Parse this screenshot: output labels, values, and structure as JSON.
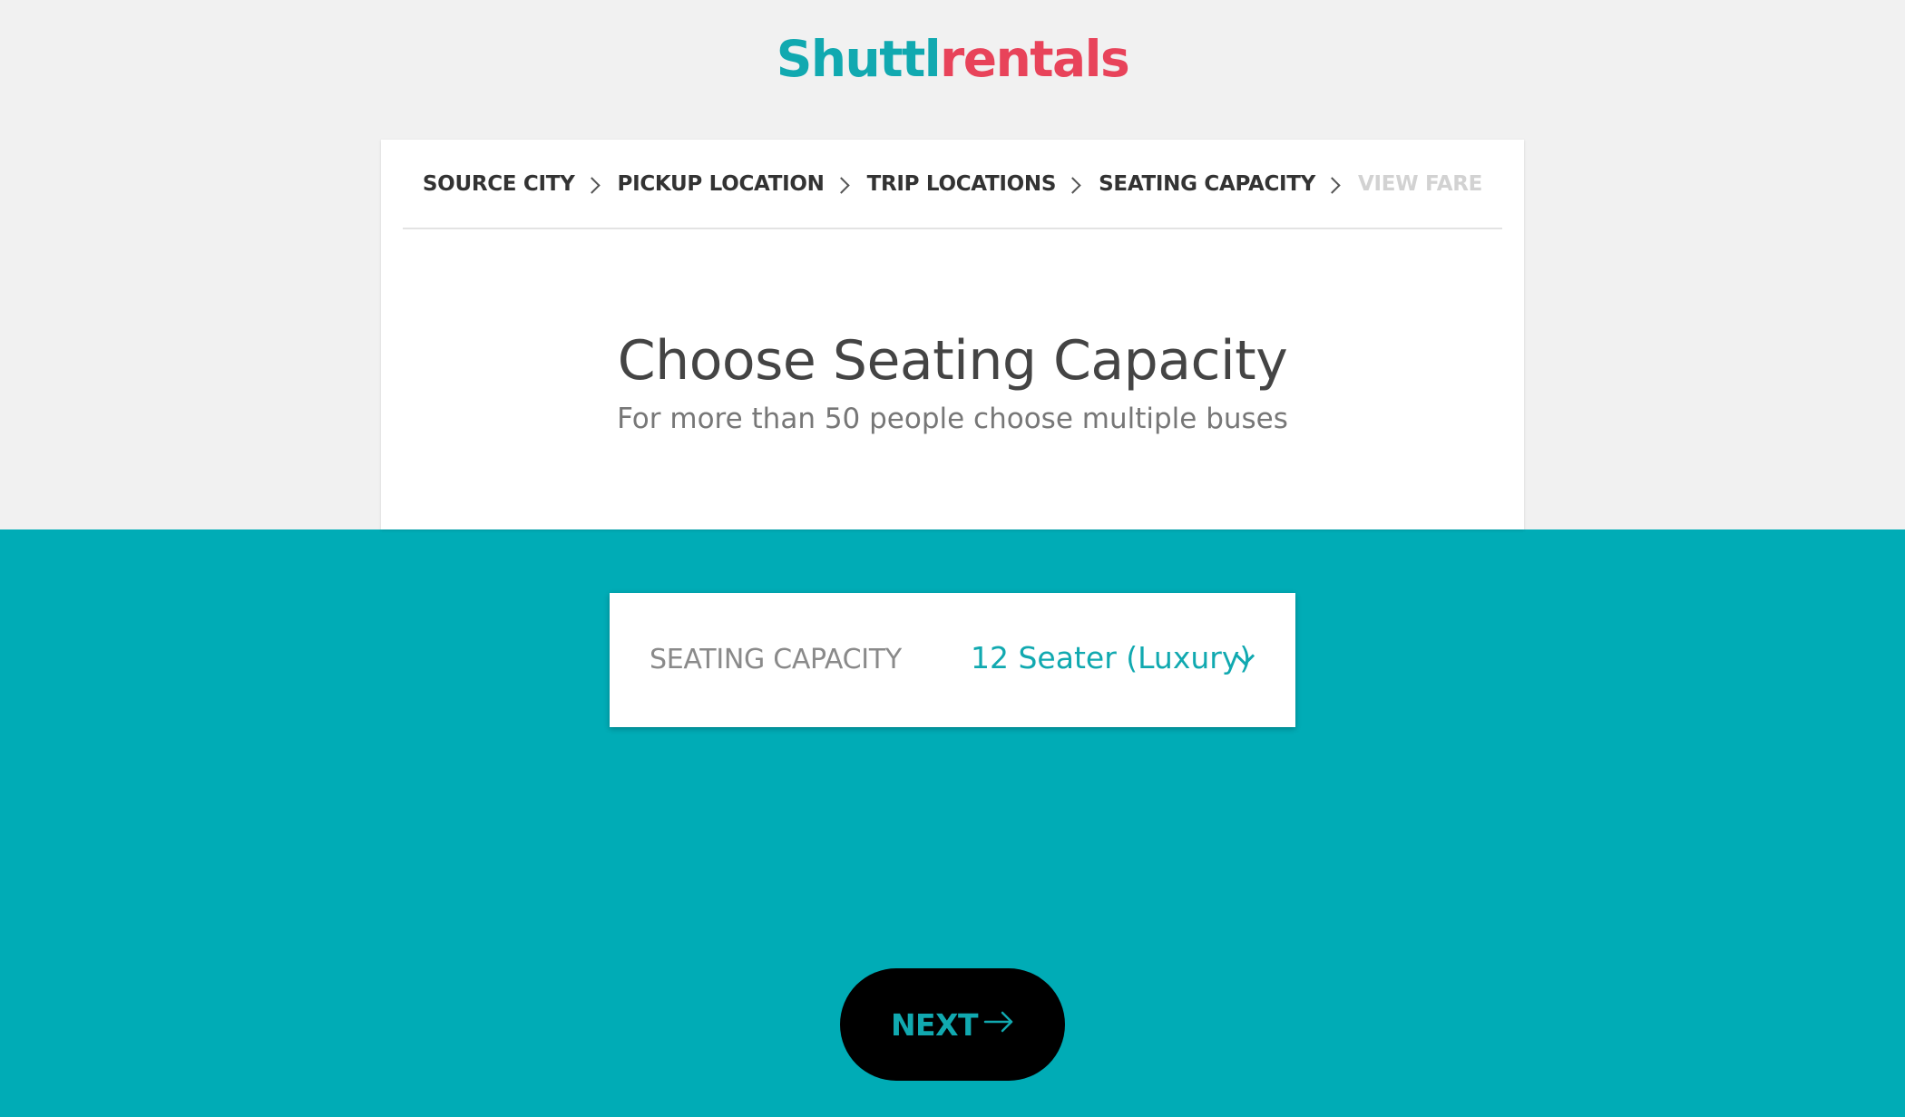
{
  "brand": {
    "logo_part1": "Shuttl",
    "logo_part2": "rentals",
    "primary_color": "#11a9b0",
    "accent_color": "#e8435a",
    "teal_bg": "#00acb6"
  },
  "breadcrumb": {
    "steps": [
      {
        "label": "SOURCE CITY",
        "state": "done"
      },
      {
        "label": "PICKUP LOCATION",
        "state": "done"
      },
      {
        "label": "TRIP LOCATIONS",
        "state": "done"
      },
      {
        "label": "SEATING CAPACITY",
        "state": "current"
      },
      {
        "label": "VIEW FARE",
        "state": "future"
      }
    ],
    "separator_icon": "chevron-right-icon"
  },
  "main": {
    "title": "Choose Seating Capacity",
    "subtitle": "For more than 50 people choose multiple buses"
  },
  "seating": {
    "label": "SEATING CAPACITY",
    "selected": "12 Seater (Luxury)",
    "dropdown_icon": "chevron-down-icon"
  },
  "next_button": {
    "label": "NEXT",
    "icon": "arrow-right-icon"
  }
}
